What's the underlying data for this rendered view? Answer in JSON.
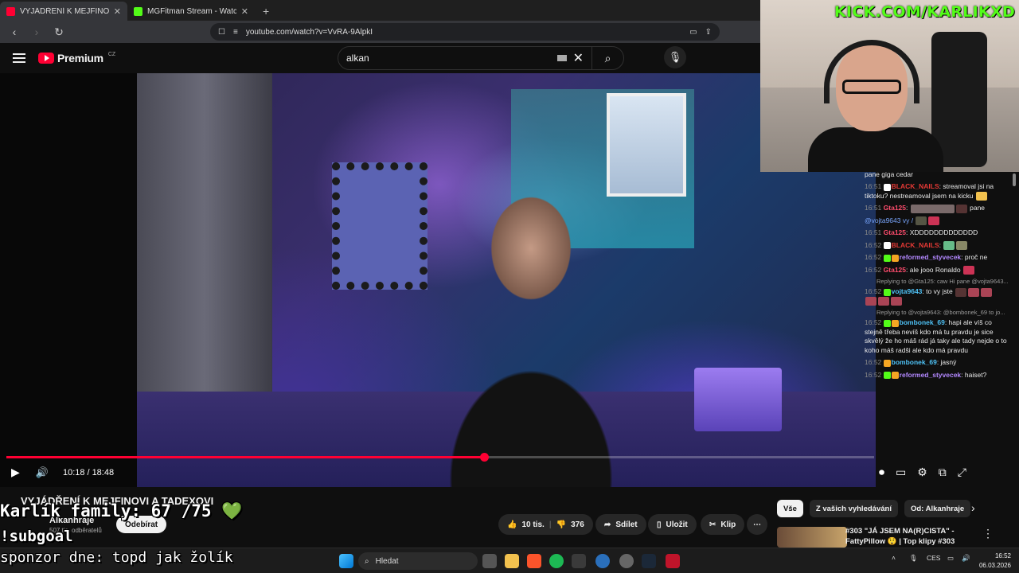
{
  "browser": {
    "tabs": [
      {
        "title": "VYJÁDŘENÍ K MEJFINOVI A TA",
        "active": true,
        "favicon_color": "#ff0033"
      },
      {
        "title": "MGFitman Stream - Watch Live on K",
        "active": false,
        "favicon_color": "#53fc18"
      }
    ],
    "url": "youtube.com/watch?v=VvRA-9AlpkI"
  },
  "youtube": {
    "logo": "Premium",
    "region": "CZ",
    "search_query": "alkan"
  },
  "player": {
    "time_current": "10:18",
    "time_total": "18:48",
    "progress": 0.55
  },
  "overlay": {
    "kick_url": "KICK.COM/KARLIKXD",
    "family_counter": "Karlík family: 67 /75 💚",
    "subgoal": "!subgoal",
    "sponsor": "sponzor dne: topd jak žolík"
  },
  "chat": {
    "messages": [
      {
        "type": "text",
        "text": "pane giga cedar",
        "color": "#eaeaea"
      },
      {
        "time": "16:51",
        "user": "BLACK_NAILS",
        "color": "#e53935",
        "text": "streamoval jsi na tiktoku? nestreamoval jsem na kicku"
      },
      {
        "time": "16:51",
        "user": "Gta125",
        "color": "#ff4d6d",
        "text": "pane"
      },
      {
        "type": "text",
        "text": "@vojta9643 vy /",
        "color": "#eaeaea"
      },
      {
        "time": "16:51",
        "user": "Gta125",
        "color": "#ff4d6d",
        "text": "XDDDDDDDDDDDDD"
      },
      {
        "time": "16:52",
        "user": "BLACK_NAILS",
        "color": "#e53935",
        "text": ""
      },
      {
        "time": "16:52",
        "user": "reformed_styvecek",
        "color": "#b388ff",
        "text": "proč ne"
      },
      {
        "time": "16:52",
        "user": "Gta125",
        "color": "#ff4d6d",
        "text": "ale jooo Ronaldo"
      },
      {
        "reply": "Replying to @Gta125: caw Hi pane @vojta9643...",
        "time": "16:52",
        "user": "vojta9643",
        "color": "#4fc3f7",
        "text": "to vy jste"
      },
      {
        "reply": "Replying to @vojta9643: @bombonek_69 to jo...",
        "time": "16:52",
        "user": "bombonek_69",
        "color": "#4fc3f7",
        "text": "hapi ale víš co stejně třeba nevíš kdo má tu pravdu je sice skvělý že ho máš rád já taky ale tady nejde o to koho máš radši ale kdo má pravdu"
      },
      {
        "time": "16:52",
        "user": "bombonek_69",
        "color": "#4fc3f7",
        "text": "jasný"
      },
      {
        "time": "16:52",
        "user": "reformed_styvecek",
        "color": "#b388ff",
        "text": "haiset?"
      }
    ]
  },
  "video_info": {
    "title": "VYJÁDŘENÍ K MEJFINOVI A TADEXOVI",
    "channel": "Alkanhraje",
    "subscribers": "507 tis. odběratelů",
    "subscribe_label": "Odebírat",
    "likes": "10 tis.",
    "dislikes": "376",
    "share_label": "Sdílet",
    "save_label": "Uložit",
    "clip_label": "Klip"
  },
  "sidebar": {
    "chips": [
      "Vše",
      "Z vašich vyhledávání",
      "Od: Alkanhraje"
    ],
    "recommended_title": "#303 \"JÁ JSEM NA(R)CISTA\" - FattyPillow 😲 | Top klipy #303"
  },
  "taskbar": {
    "search_placeholder": "Hledat",
    "language": "CES",
    "time": "16:52",
    "date": "06.03.2026"
  }
}
